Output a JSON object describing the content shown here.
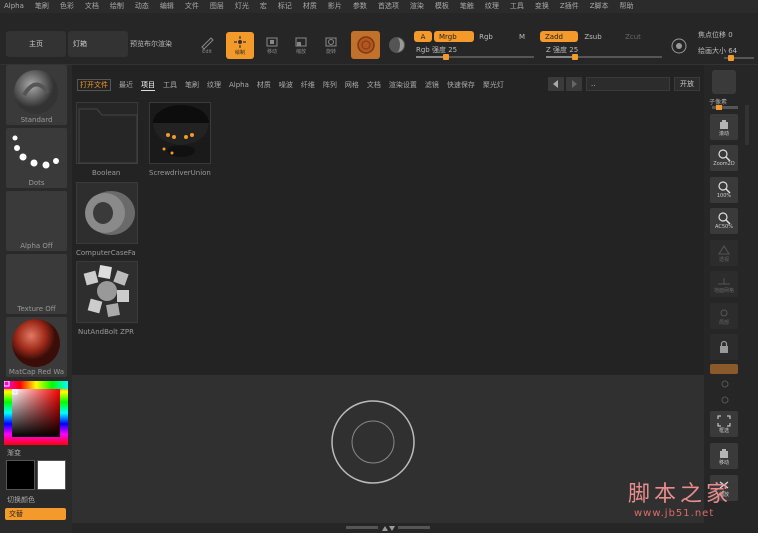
{
  "menubar": {
    "items": [
      "Alpha",
      "笔刷",
      "色彩",
      "文档",
      "绘制",
      "动态",
      "编辑",
      "文件",
      "图层",
      "灯光",
      "宏",
      "标记",
      "材质",
      "影片",
      "参数",
      "首选项",
      "渲染",
      "模板",
      "笔触",
      "纹理",
      "工具",
      "变换",
      "Z插件",
      "Z脚本",
      "帮助"
    ]
  },
  "toolbar": {
    "home_tab": "主页",
    "lightbox_tab": "灯箱",
    "preview_tab": "预览布尔渲染",
    "edit_label": "Edit",
    "draw_label": "绘制",
    "move_label": "移动",
    "scale_label": "缩放",
    "rotate_label": "旋转",
    "a_label": "A",
    "mrgb_label": "Mrgb",
    "rgb_label": "Rgb",
    "m_label": "M",
    "rgb_intensity_label": "Rgb 强度 25",
    "zadd_label": "Zadd",
    "zsub_label": "Zsub",
    "zcut_label": "Zcut",
    "z_intensity_label": "Z 强度 25",
    "focal_shift_label": "焦点位移 0",
    "draw_size_label": "绘画大小 64",
    "rgb_intensity_value": 25,
    "z_intensity_value": 25,
    "accent_color": "#f39a2a"
  },
  "leftpanel": {
    "brush_label": "Standard",
    "stroke_label": "Dots",
    "alpha_label": "Alpha Off",
    "texture_label": "Texture Off",
    "material_label": "MatCap Red Wa",
    "gradient_label": "渐变",
    "switch_color_label": "切换颜色",
    "alternate_label": "交替"
  },
  "lightbox": {
    "tabs": [
      "打开文件",
      "最近",
      "项目",
      "工具",
      "笔刷",
      "纹理",
      "Alpha",
      "材质",
      "噪波",
      "纤维",
      "阵列",
      "网格",
      "文档",
      "渲染设置",
      "滤镜",
      "快速保存",
      "聚光灯"
    ],
    "open_label": "开放",
    "search_value": "..",
    "thumbnails": [
      "Boolean",
      "ScrewdriverUnion",
      "ComputerCaseFa",
      "NutAndBolt ZPR"
    ]
  },
  "rightshelf": {
    "subdiv_label": "子像素",
    "scroll_label": "滚动",
    "zoom2d_label": "Zoom2D",
    "pct100_label": "100%",
    "ac50_label": "AC50%",
    "persp_label": "透视",
    "floor_label": "地面网格",
    "local_label": "局部",
    "lock_label": "",
    "frame_label": "框选",
    "move_label": "移动",
    "scale_label": "缩放"
  },
  "watermark": {
    "title": "脚本之家",
    "url": "www.jb51.net"
  }
}
